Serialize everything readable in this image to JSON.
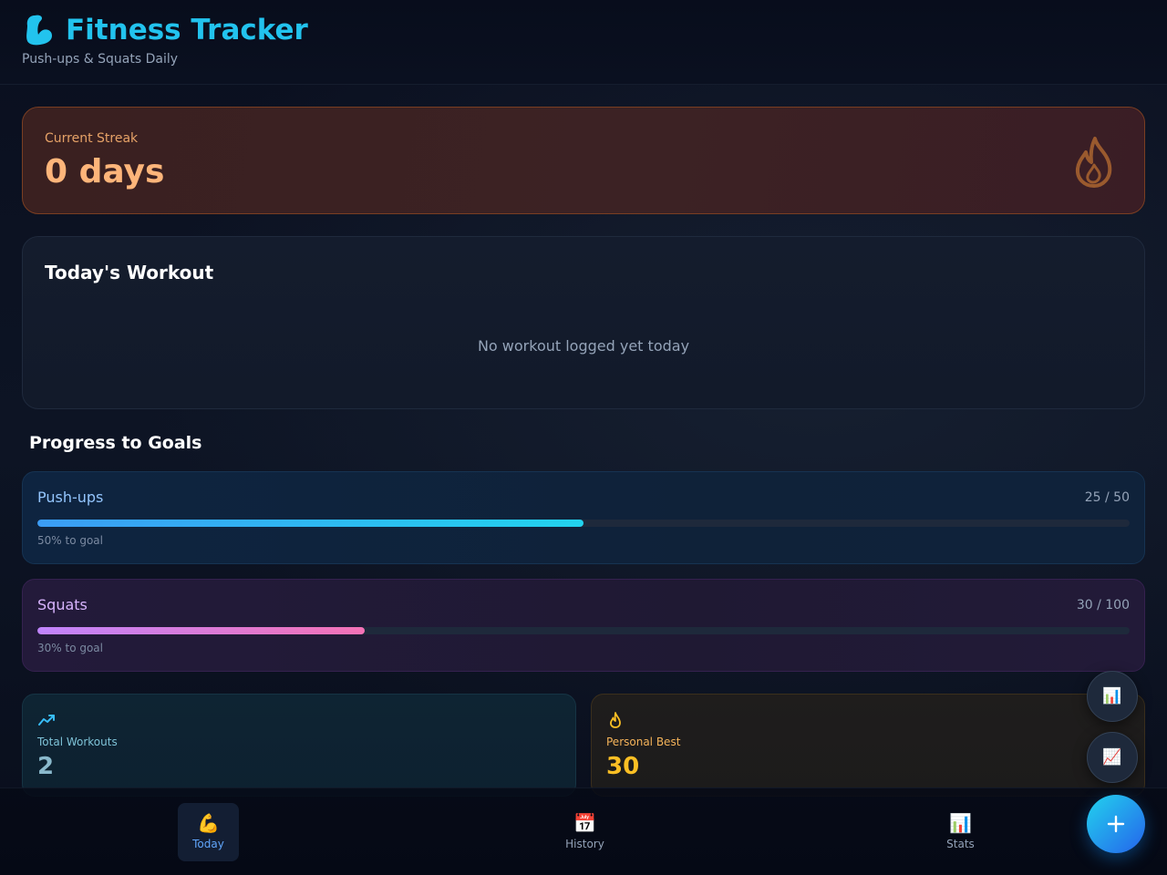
{
  "header": {
    "title": "Fitness Tracker",
    "subtitle": "Push-ups & Squats Daily",
    "title_icon": "flexed-biceps-icon"
  },
  "streak": {
    "label": "Current Streak",
    "value": "0 days",
    "icon": "flame-icon"
  },
  "workout": {
    "title": "Today's Workout",
    "empty_message": "No workout logged yet today"
  },
  "goals": {
    "section_title": "Progress to Goals",
    "items": [
      {
        "name": "Push-ups",
        "count": "25 / 50",
        "caption": "50% to goal",
        "percent": 50,
        "color": "#22d3ee"
      },
      {
        "name": "Squats",
        "count": "30 / 100",
        "caption": "30% to goal",
        "percent": 30,
        "color": "#f472b6"
      }
    ]
  },
  "stats": {
    "total": {
      "label": "Total Workouts",
      "value": "2",
      "icon": "trending-up-icon"
    },
    "best": {
      "label": "Personal Best",
      "value": "30",
      "icon": "flame-icon"
    }
  },
  "nav": {
    "items": [
      {
        "label": "Today",
        "icon": "💪",
        "active": true
      },
      {
        "label": "History",
        "icon": "📅",
        "active": false
      },
      {
        "label": "Stats",
        "icon": "📊",
        "active": false
      }
    ]
  },
  "fabs": {
    "chart_icon": "📊",
    "trend_icon": "📈",
    "add_icon": "plus-icon"
  },
  "colors": {
    "accent": "#22c3ee",
    "streak": "#fdb57a",
    "best": "#fbbf24"
  }
}
